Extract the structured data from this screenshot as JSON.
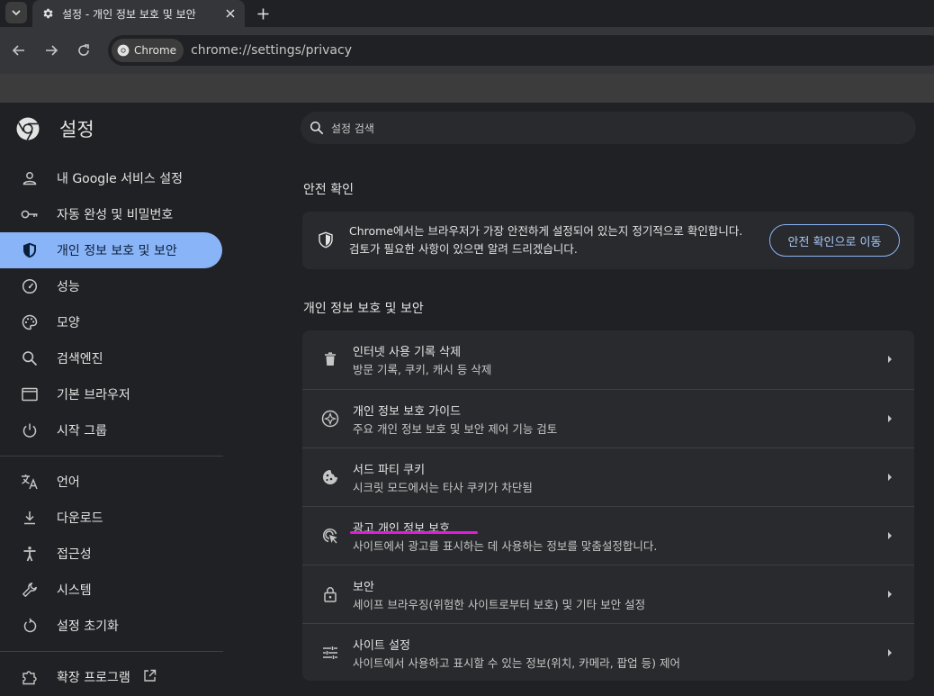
{
  "tabstrip": {
    "tab_title": "설정 - 개인 정보 보호 및 보안"
  },
  "toolbar": {
    "chip_label": "Chrome",
    "url": "chrome://settings/privacy"
  },
  "sidebar": {
    "title": "설정",
    "items": [
      {
        "label": "내 Google 서비스 설정",
        "icon": "person-icon"
      },
      {
        "label": "자동 완성 및 비밀번호",
        "icon": "key-icon"
      },
      {
        "label": "개인 정보 보호 및 보안",
        "icon": "shield-icon",
        "active": true
      },
      {
        "label": "성능",
        "icon": "speedometer-icon"
      },
      {
        "label": "모양",
        "icon": "palette-icon"
      },
      {
        "label": "검색엔진",
        "icon": "search-icon"
      },
      {
        "label": "기본 브라우저",
        "icon": "browser-icon"
      },
      {
        "label": "시작 그룹",
        "icon": "power-icon"
      },
      {
        "label": "언어",
        "icon": "translate-icon"
      },
      {
        "label": "다운로드",
        "icon": "download-icon"
      },
      {
        "label": "접근성",
        "icon": "accessibility-icon"
      },
      {
        "label": "시스템",
        "icon": "wrench-icon"
      },
      {
        "label": "설정 초기화",
        "icon": "reset-icon"
      },
      {
        "label": "확장 프로그램",
        "icon": "extension-icon"
      }
    ]
  },
  "search": {
    "placeholder": "설정 검색"
  },
  "safety_check": {
    "section_title": "안전 확인",
    "text": "Chrome에서는 브라우저가 가장 안전하게 설정되어 있는지 정기적으로 확인합니다. 검토가 필요한 사항이 있으면 알려 드리겠습니다.",
    "button_label": "안전 확인으로 이동"
  },
  "privacy": {
    "section_title": "개인 정보 보호 및 보안",
    "rows": [
      {
        "title": "인터넷 사용 기록 삭제",
        "subtitle": "방문 기록, 쿠키, 캐시 등 삭제",
        "icon": "trash-icon"
      },
      {
        "title": "개인 정보 보호 가이드",
        "subtitle": "주요 개인 정보 보호 및 보안 제어 기능 검토",
        "icon": "compass-icon"
      },
      {
        "title": "서드 파티 쿠키",
        "subtitle": "시크릿 모드에서는 타사 쿠키가 차단됨",
        "icon": "cookie-icon"
      },
      {
        "title": "광고 개인 정보 보호",
        "subtitle": "사이트에서 광고를 표시하는 데 사용하는 정보를 맞춤설정합니다.",
        "icon": "ad-privacy-icon"
      },
      {
        "title": "보안",
        "subtitle": "세이프 브라우징(위험한 사이트로부터 보호) 및 기타 보안 설정",
        "icon": "lock-icon"
      },
      {
        "title": "사이트 설정",
        "subtitle": "사이트에서 사용하고 표시할 수 있는 정보(위치, 카메라, 팝업 등) 제어",
        "icon": "tune-icon"
      }
    ]
  },
  "colors": {
    "active_nav": "#8ab4f8",
    "annotation_underline": "#e31bdc"
  }
}
